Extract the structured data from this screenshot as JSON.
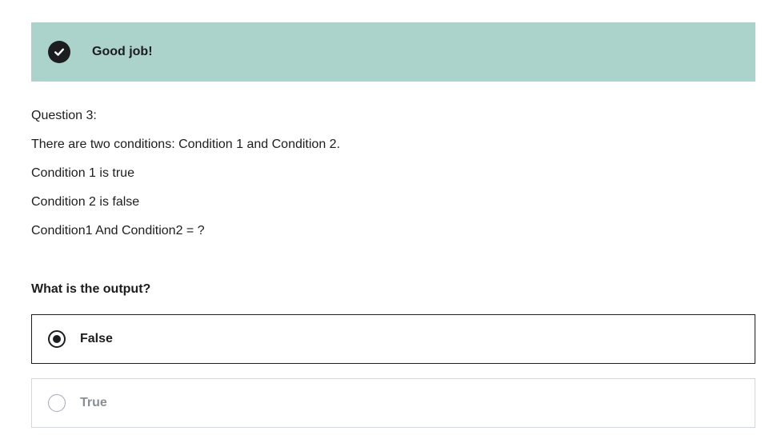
{
  "feedback": {
    "icon": "check-circle-icon",
    "message": "Good job!",
    "background_color": "#acd2cc"
  },
  "question": {
    "lines": [
      "Question 3:",
      "There are two conditions: Condition 1 and Condition 2.",
      "Condition 1 is true",
      "Condition 2 is false",
      "Condition1 And Condition2 = ?"
    ],
    "prompt": "What is the output?"
  },
  "answers": [
    {
      "label": "False",
      "selected": true
    },
    {
      "label": "True",
      "selected": false
    }
  ]
}
